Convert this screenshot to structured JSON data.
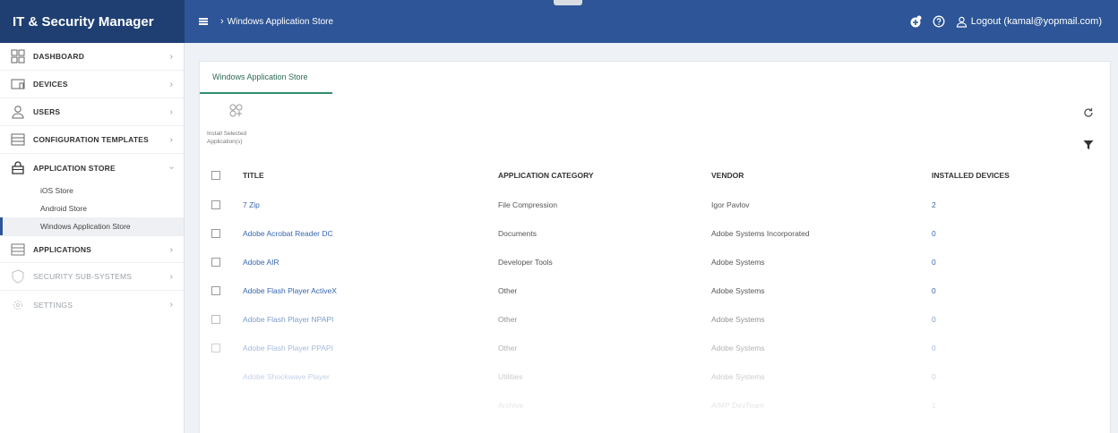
{
  "app": {
    "title": "IT & Security Manager",
    "breadcrumb": "Windows Application Store",
    "logout_label": "Logout (kamal@yopmail.com)"
  },
  "sidebar": {
    "items": [
      {
        "label": "DASHBOARD",
        "icon": "dashboard-icon"
      },
      {
        "label": "DEVICES",
        "icon": "devices-icon"
      },
      {
        "label": "USERS",
        "icon": "user-icon"
      },
      {
        "label": "CONFIGURATION TEMPLATES",
        "icon": "templates-icon"
      },
      {
        "label": "APPLICATION STORE",
        "icon": "store-icon"
      },
      {
        "label": "APPLICATIONS",
        "icon": "applications-icon"
      },
      {
        "label": "SECURITY SUB-SYSTEMS",
        "icon": "shield-icon"
      },
      {
        "label": "SETTINGS",
        "icon": "gear-icon"
      }
    ],
    "subitems": [
      "iOS Store",
      "Android Store",
      "Windows Application Store"
    ]
  },
  "main": {
    "tab": "Windows Application Store",
    "install_label": "Install Selected Application(s)",
    "columns": [
      "TITLE",
      "APPLICATION CATEGORY",
      "VENDOR",
      "INSTALLED DEVICES"
    ],
    "rows": [
      {
        "title": "7 Zip",
        "category": "File Compression",
        "vendor": "Igor Pavlov",
        "installed": "2"
      },
      {
        "title": "Adobe Acrobat Reader DC",
        "category": "Documents",
        "vendor": "Adobe Systems Incorporated",
        "installed": "0"
      },
      {
        "title": "Adobe AIR",
        "category": "Developer Tools",
        "vendor": "Adobe Systems",
        "installed": "0"
      },
      {
        "title": "Adobe Flash Player ActiveX",
        "category": "Other",
        "vendor": "Adobe Systems",
        "installed": "0"
      },
      {
        "title": "Adobe Flash Player NPAPI",
        "category": "Other",
        "vendor": "Adobe Systems",
        "installed": "0"
      },
      {
        "title": "Adobe Flash Player PPAPI",
        "category": "Other",
        "vendor": "Adobe Systems",
        "installed": "0"
      },
      {
        "title": "Adobe Shockwave Player",
        "category": "Utilities",
        "vendor": "Adobe Systems",
        "installed": "0"
      },
      {
        "title": "",
        "category": "Archive",
        "vendor": "AIMP DevTeam",
        "installed": "1"
      }
    ]
  },
  "colors": {
    "topbar": "#2d5597",
    "brand_bg": "#1f3f73",
    "link": "#3666b0",
    "tab_accent": "#2f8d6e"
  }
}
